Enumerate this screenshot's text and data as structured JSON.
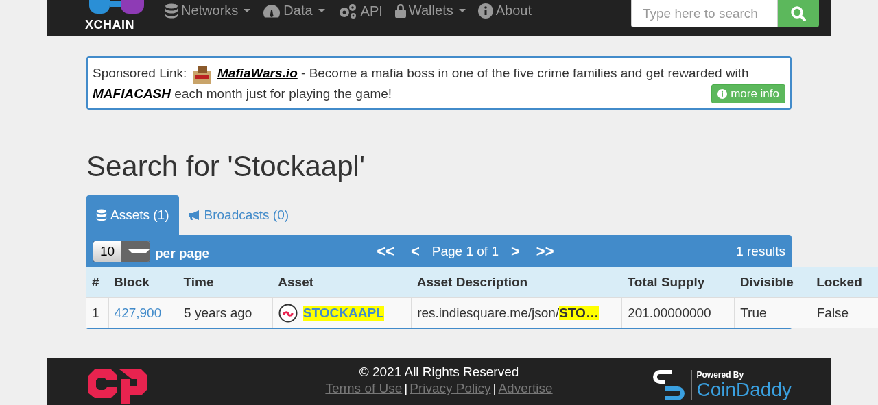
{
  "navbar": {
    "brand": "XCHAIN",
    "items": [
      {
        "label": "Networks",
        "dropdown": true
      },
      {
        "label": "Data",
        "dropdown": true
      },
      {
        "label": "API",
        "dropdown": false
      },
      {
        "label": "Wallets",
        "dropdown": true
      },
      {
        "label": "About",
        "dropdown": false
      }
    ],
    "search": {
      "placeholder": "Type here to search"
    }
  },
  "sponsor": {
    "prefix": "Sponsored Link:",
    "link": "MafiaWars.io",
    "text": " - Become a mafia boss in one of the five crime families and get rewarded with ",
    "link2": "MAFIACASH",
    "text2": " each month just for playing the game!",
    "button": "more info"
  },
  "heading": "Search for 'Stockaapl'",
  "tabs": [
    {
      "label": "Assets (1)",
      "selected": true
    },
    {
      "label": "Broadcasts (0)",
      "selected": false
    }
  ],
  "pager": {
    "per_page_value": "10",
    "per_page_label": "per page",
    "first": "<<",
    "prev": "<",
    "page": "Page 1 of 1",
    "next": ">",
    "last": ">>",
    "results": "1 results"
  },
  "table": {
    "columns": [
      "#",
      "Block",
      "Time",
      "Asset",
      "Asset Description",
      "Total Supply",
      "Divisible",
      "Locked"
    ],
    "rows": [
      {
        "index": "1",
        "block": "427,900",
        "time": "5 years ago",
        "asset": "STOCKAAPL",
        "description": "res.indiesquare.me/json/",
        "description_match": "STO…",
        "supply": "201.00000000",
        "divisible": "True",
        "locked": "False"
      }
    ]
  },
  "footer": {
    "copyright": "© 2021 All Rights Reserved",
    "links": [
      "Terms of Use",
      "Privacy Policy",
      "Advertise"
    ],
    "separators": [
      "|",
      "|"
    ],
    "powered_by": "Powered By",
    "sponsor_name": "CoinDaddy"
  }
}
